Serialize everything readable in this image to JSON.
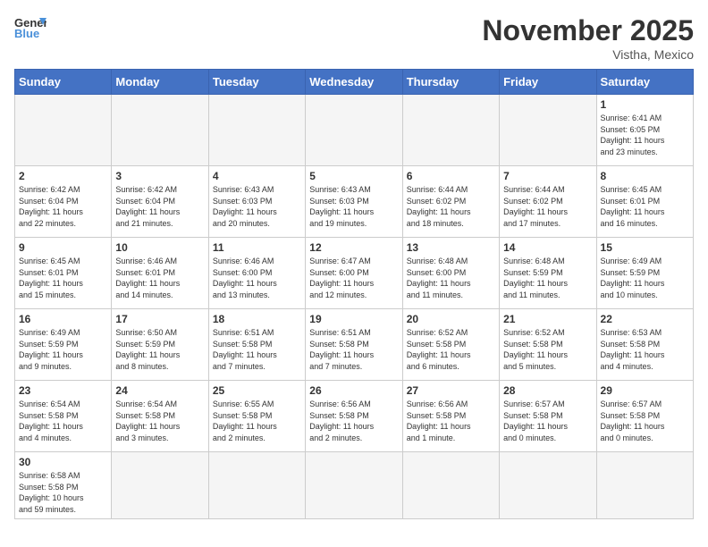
{
  "header": {
    "logo_general": "General",
    "logo_blue": "Blue",
    "month_title": "November 2025",
    "location": "Vistha, Mexico"
  },
  "days_of_week": [
    "Sunday",
    "Monday",
    "Tuesday",
    "Wednesday",
    "Thursday",
    "Friday",
    "Saturday"
  ],
  "weeks": [
    [
      {
        "num": "",
        "info": "",
        "empty": true
      },
      {
        "num": "",
        "info": "",
        "empty": true
      },
      {
        "num": "",
        "info": "",
        "empty": true
      },
      {
        "num": "",
        "info": "",
        "empty": true
      },
      {
        "num": "",
        "info": "",
        "empty": true
      },
      {
        "num": "",
        "info": "",
        "empty": true
      },
      {
        "num": "1",
        "info": "Sunrise: 6:41 AM\nSunset: 6:05 PM\nDaylight: 11 hours\nand 23 minutes."
      }
    ],
    [
      {
        "num": "2",
        "info": "Sunrise: 6:42 AM\nSunset: 6:04 PM\nDaylight: 11 hours\nand 22 minutes."
      },
      {
        "num": "3",
        "info": "Sunrise: 6:42 AM\nSunset: 6:04 PM\nDaylight: 11 hours\nand 21 minutes."
      },
      {
        "num": "4",
        "info": "Sunrise: 6:43 AM\nSunset: 6:03 PM\nDaylight: 11 hours\nand 20 minutes."
      },
      {
        "num": "5",
        "info": "Sunrise: 6:43 AM\nSunset: 6:03 PM\nDaylight: 11 hours\nand 19 minutes."
      },
      {
        "num": "6",
        "info": "Sunrise: 6:44 AM\nSunset: 6:02 PM\nDaylight: 11 hours\nand 18 minutes."
      },
      {
        "num": "7",
        "info": "Sunrise: 6:44 AM\nSunset: 6:02 PM\nDaylight: 11 hours\nand 17 minutes."
      },
      {
        "num": "8",
        "info": "Sunrise: 6:45 AM\nSunset: 6:01 PM\nDaylight: 11 hours\nand 16 minutes."
      }
    ],
    [
      {
        "num": "9",
        "info": "Sunrise: 6:45 AM\nSunset: 6:01 PM\nDaylight: 11 hours\nand 15 minutes."
      },
      {
        "num": "10",
        "info": "Sunrise: 6:46 AM\nSunset: 6:01 PM\nDaylight: 11 hours\nand 14 minutes."
      },
      {
        "num": "11",
        "info": "Sunrise: 6:46 AM\nSunset: 6:00 PM\nDaylight: 11 hours\nand 13 minutes."
      },
      {
        "num": "12",
        "info": "Sunrise: 6:47 AM\nSunset: 6:00 PM\nDaylight: 11 hours\nand 12 minutes."
      },
      {
        "num": "13",
        "info": "Sunrise: 6:48 AM\nSunset: 6:00 PM\nDaylight: 11 hours\nand 11 minutes."
      },
      {
        "num": "14",
        "info": "Sunrise: 6:48 AM\nSunset: 5:59 PM\nDaylight: 11 hours\nand 11 minutes."
      },
      {
        "num": "15",
        "info": "Sunrise: 6:49 AM\nSunset: 5:59 PM\nDaylight: 11 hours\nand 10 minutes."
      }
    ],
    [
      {
        "num": "16",
        "info": "Sunrise: 6:49 AM\nSunset: 5:59 PM\nDaylight: 11 hours\nand 9 minutes."
      },
      {
        "num": "17",
        "info": "Sunrise: 6:50 AM\nSunset: 5:59 PM\nDaylight: 11 hours\nand 8 minutes."
      },
      {
        "num": "18",
        "info": "Sunrise: 6:51 AM\nSunset: 5:58 PM\nDaylight: 11 hours\nand 7 minutes."
      },
      {
        "num": "19",
        "info": "Sunrise: 6:51 AM\nSunset: 5:58 PM\nDaylight: 11 hours\nand 7 minutes."
      },
      {
        "num": "20",
        "info": "Sunrise: 6:52 AM\nSunset: 5:58 PM\nDaylight: 11 hours\nand 6 minutes."
      },
      {
        "num": "21",
        "info": "Sunrise: 6:52 AM\nSunset: 5:58 PM\nDaylight: 11 hours\nand 5 minutes."
      },
      {
        "num": "22",
        "info": "Sunrise: 6:53 AM\nSunset: 5:58 PM\nDaylight: 11 hours\nand 4 minutes."
      }
    ],
    [
      {
        "num": "23",
        "info": "Sunrise: 6:54 AM\nSunset: 5:58 PM\nDaylight: 11 hours\nand 4 minutes."
      },
      {
        "num": "24",
        "info": "Sunrise: 6:54 AM\nSunset: 5:58 PM\nDaylight: 11 hours\nand 3 minutes."
      },
      {
        "num": "25",
        "info": "Sunrise: 6:55 AM\nSunset: 5:58 PM\nDaylight: 11 hours\nand 2 minutes."
      },
      {
        "num": "26",
        "info": "Sunrise: 6:56 AM\nSunset: 5:58 PM\nDaylight: 11 hours\nand 2 minutes."
      },
      {
        "num": "27",
        "info": "Sunrise: 6:56 AM\nSunset: 5:58 PM\nDaylight: 11 hours\nand 1 minute."
      },
      {
        "num": "28",
        "info": "Sunrise: 6:57 AM\nSunset: 5:58 PM\nDaylight: 11 hours\nand 0 minutes."
      },
      {
        "num": "29",
        "info": "Sunrise: 6:57 AM\nSunset: 5:58 PM\nDaylight: 11 hours\nand 0 minutes."
      }
    ],
    [
      {
        "num": "30",
        "info": "Sunrise: 6:58 AM\nSunset: 5:58 PM\nDaylight: 10 hours\nand 59 minutes.",
        "last": true
      },
      {
        "num": "",
        "info": "",
        "empty": true,
        "last": true
      },
      {
        "num": "",
        "info": "",
        "empty": true,
        "last": true
      },
      {
        "num": "",
        "info": "",
        "empty": true,
        "last": true
      },
      {
        "num": "",
        "info": "",
        "empty": true,
        "last": true
      },
      {
        "num": "",
        "info": "",
        "empty": true,
        "last": true
      },
      {
        "num": "",
        "info": "",
        "empty": true,
        "last": true
      }
    ]
  ]
}
